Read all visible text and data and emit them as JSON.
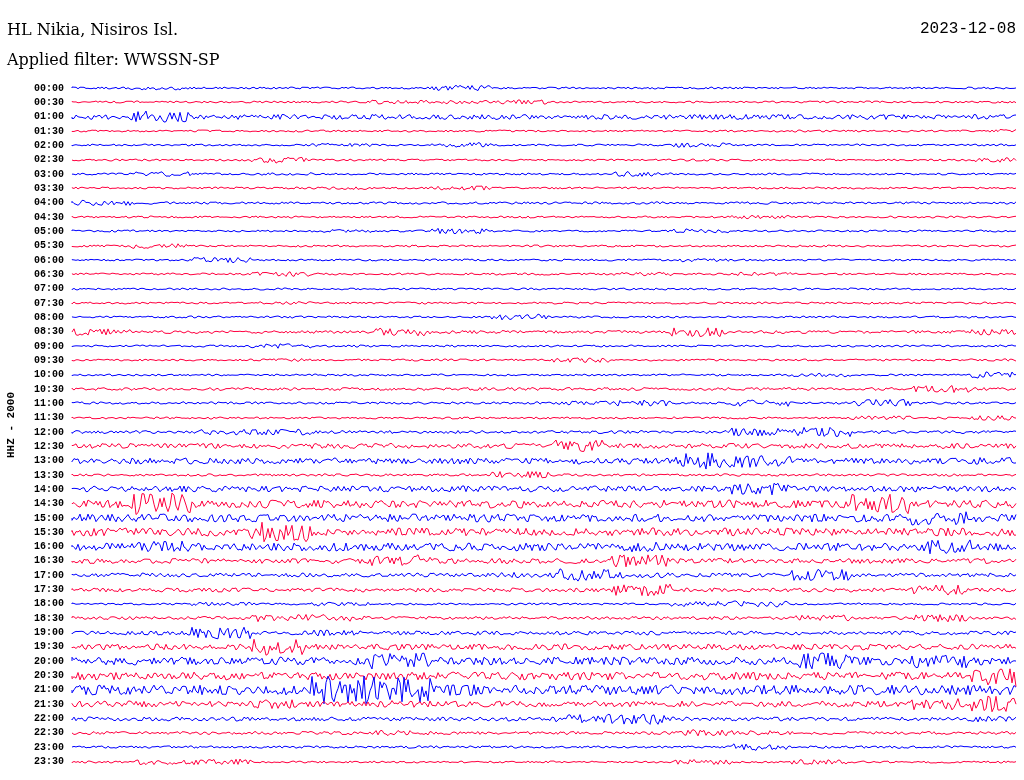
{
  "header": {
    "station": "HL Nikia, Nisiros Isl.",
    "date": "2023-12-08",
    "filter": "Applied filter: WWSSN-SP"
  },
  "axis_label": "HHZ - 2000",
  "rows": [
    {
      "time": "00:00",
      "color": "#0000ff"
    },
    {
      "time": "00:30",
      "color": "#ff0040"
    },
    {
      "time": "01:00",
      "color": "#0000ff"
    },
    {
      "time": "01:30",
      "color": "#ff0040"
    },
    {
      "time": "02:00",
      "color": "#0000ff"
    },
    {
      "time": "02:30",
      "color": "#ff0040"
    },
    {
      "time": "03:00",
      "color": "#0000ff"
    },
    {
      "time": "03:30",
      "color": "#ff0040"
    },
    {
      "time": "04:00",
      "color": "#0000ff"
    },
    {
      "time": "04:30",
      "color": "#ff0040"
    },
    {
      "time": "05:00",
      "color": "#0000ff"
    },
    {
      "time": "05:30",
      "color": "#ff0040"
    },
    {
      "time": "06:00",
      "color": "#0000ff"
    },
    {
      "time": "06:30",
      "color": "#ff0040"
    },
    {
      "time": "07:00",
      "color": "#0000ff"
    },
    {
      "time": "07:30",
      "color": "#ff0040"
    },
    {
      "time": "08:00",
      "color": "#0000ff"
    },
    {
      "time": "08:30",
      "color": "#ff0040"
    },
    {
      "time": "09:00",
      "color": "#0000ff"
    },
    {
      "time": "09:30",
      "color": "#ff0040"
    },
    {
      "time": "10:00",
      "color": "#0000ff"
    },
    {
      "time": "10:30",
      "color": "#ff0040"
    },
    {
      "time": "11:00",
      "color": "#0000ff"
    },
    {
      "time": "11:30",
      "color": "#ff0040"
    },
    {
      "time": "12:00",
      "color": "#0000ff"
    },
    {
      "time": "12:30",
      "color": "#ff0040"
    },
    {
      "time": "13:00",
      "color": "#0000ff"
    },
    {
      "time": "13:30",
      "color": "#ff0040"
    },
    {
      "time": "14:00",
      "color": "#0000ff"
    },
    {
      "time": "14:30",
      "color": "#ff0040"
    },
    {
      "time": "15:00",
      "color": "#0000ff"
    },
    {
      "time": "15:30",
      "color": "#ff0040"
    },
    {
      "time": "16:00",
      "color": "#0000ff"
    },
    {
      "time": "16:30",
      "color": "#ff0040"
    },
    {
      "time": "17:00",
      "color": "#0000ff"
    },
    {
      "time": "17:30",
      "color": "#ff0040"
    },
    {
      "time": "18:00",
      "color": "#0000ff"
    },
    {
      "time": "18:30",
      "color": "#ff0040"
    },
    {
      "time": "19:00",
      "color": "#0000ff"
    },
    {
      "time": "19:30",
      "color": "#ff0040"
    },
    {
      "time": "20:00",
      "color": "#0000ff"
    },
    {
      "time": "20:30",
      "color": "#ff0040"
    },
    {
      "time": "21:00",
      "color": "#0000ff"
    },
    {
      "time": "21:30",
      "color": "#ff0040"
    },
    {
      "time": "22:00",
      "color": "#0000ff"
    },
    {
      "time": "22:30",
      "color": "#ff0040"
    },
    {
      "time": "23:00",
      "color": "#0000ff"
    },
    {
      "time": "23:30",
      "color": "#ff0040"
    }
  ]
}
